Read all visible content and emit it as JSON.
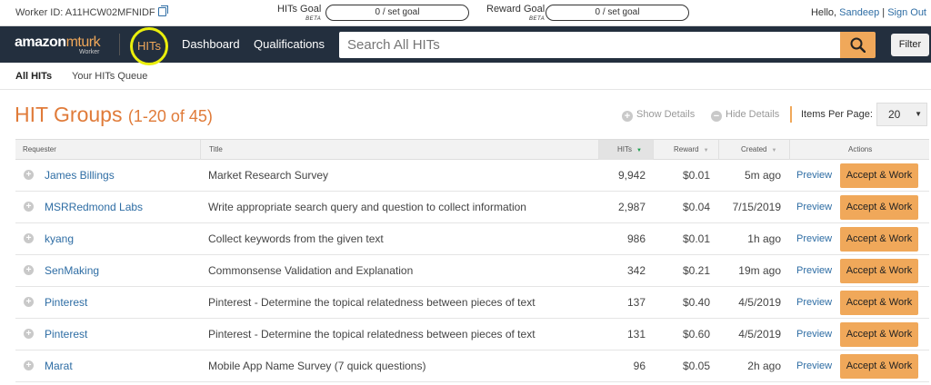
{
  "topbar": {
    "worker_label": "Worker ID: A11HCW02MFNIDF",
    "hits_goal_label": "HITs Goal",
    "hits_goal_beta": "BETA",
    "hits_goal_text": "0  /  set goal",
    "reward_goal_label": "Reward Goal",
    "reward_goal_beta": "BETA",
    "reward_goal_text": "0  /  set goal",
    "hello": "Hello,",
    "user_name": "Sandeep",
    "separator": "|",
    "sign_out": "Sign Out"
  },
  "navbar": {
    "logo_brand": "amazon",
    "logo_product": "mturk",
    "logo_sub": "Worker",
    "hits": "HITs",
    "dashboard": "Dashboard",
    "qualifications": "Qualifications",
    "search_placeholder": "Search All HITs",
    "filter": "Filter"
  },
  "subnav": {
    "all_hits": "All HITs",
    "queue": "Your HITs Queue"
  },
  "heading": {
    "title": "HIT Groups",
    "range": "(1-20 of 45)",
    "show_details": "Show Details",
    "hide_details": "Hide Details",
    "items_per_page_label": "Items Per Page:",
    "items_per_page_value": "20"
  },
  "table": {
    "columns": {
      "requester": "Requester",
      "title": "Title",
      "hits": "HITs",
      "reward": "Reward",
      "created": "Created",
      "actions": "Actions"
    },
    "preview_label": "Preview",
    "accept_label": "Accept & Work",
    "rows": [
      {
        "requester": "James Billings",
        "title": "Market Research Survey",
        "hits": "9,942",
        "reward": "$0.01",
        "created": "5m ago"
      },
      {
        "requester": "MSRRedmond Labs",
        "title": "Write appropriate search query and question to collect information",
        "hits": "2,987",
        "reward": "$0.04",
        "created": "7/15/2019"
      },
      {
        "requester": "kyang",
        "title": "Collect keywords from the given text",
        "hits": "986",
        "reward": "$0.01",
        "created": "1h ago"
      },
      {
        "requester": "SenMaking",
        "title": "Commonsense Validation and Explanation",
        "hits": "342",
        "reward": "$0.21",
        "created": "19m ago"
      },
      {
        "requester": "Pinterest",
        "title": "Pinterest - Determine the topical relatedness between pieces of text",
        "hits": "137",
        "reward": "$0.40",
        "created": "4/5/2019"
      },
      {
        "requester": "Pinterest",
        "title": "Pinterest - Determine the topical relatedness between pieces of text",
        "hits": "131",
        "reward": "$0.60",
        "created": "4/5/2019"
      },
      {
        "requester": "Marat",
        "title": "Mobile App Name Survey (7 quick questions)",
        "hits": "96",
        "reward": "$0.05",
        "created": "2h ago"
      }
    ]
  },
  "colors": {
    "nav_bg": "#232f3e",
    "accent_orange": "#f0a85a",
    "heading_orange": "#e07b39",
    "link_blue": "#2e6da4",
    "highlight_circle": "#ebef0c"
  }
}
